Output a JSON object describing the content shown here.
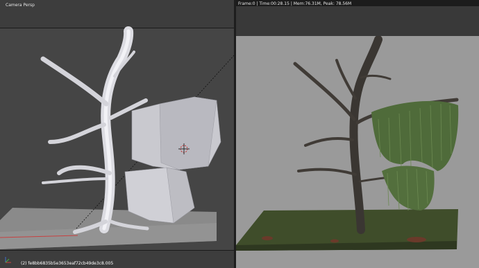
{
  "viewport": {
    "title": "Camera Persp",
    "info": "(2) fe8bb6835b5e3653eaf72cb49de3c8.005",
    "icons": [
      "3d-cursor-icon",
      "axis-gizmo-icon"
    ]
  },
  "render_view": {
    "info": "Frame:0 | Time:00:28.15 | Mem:76.31M, Peak: 78.56M"
  },
  "colors": {
    "viewport_bg": "#3d3d3d",
    "render_bg": "#9a9a9a",
    "tree_solid": "#d8d8de",
    "tree_render": "#3e3a36",
    "foliage": "#4f6b3a",
    "ground": "#3d4a28"
  }
}
